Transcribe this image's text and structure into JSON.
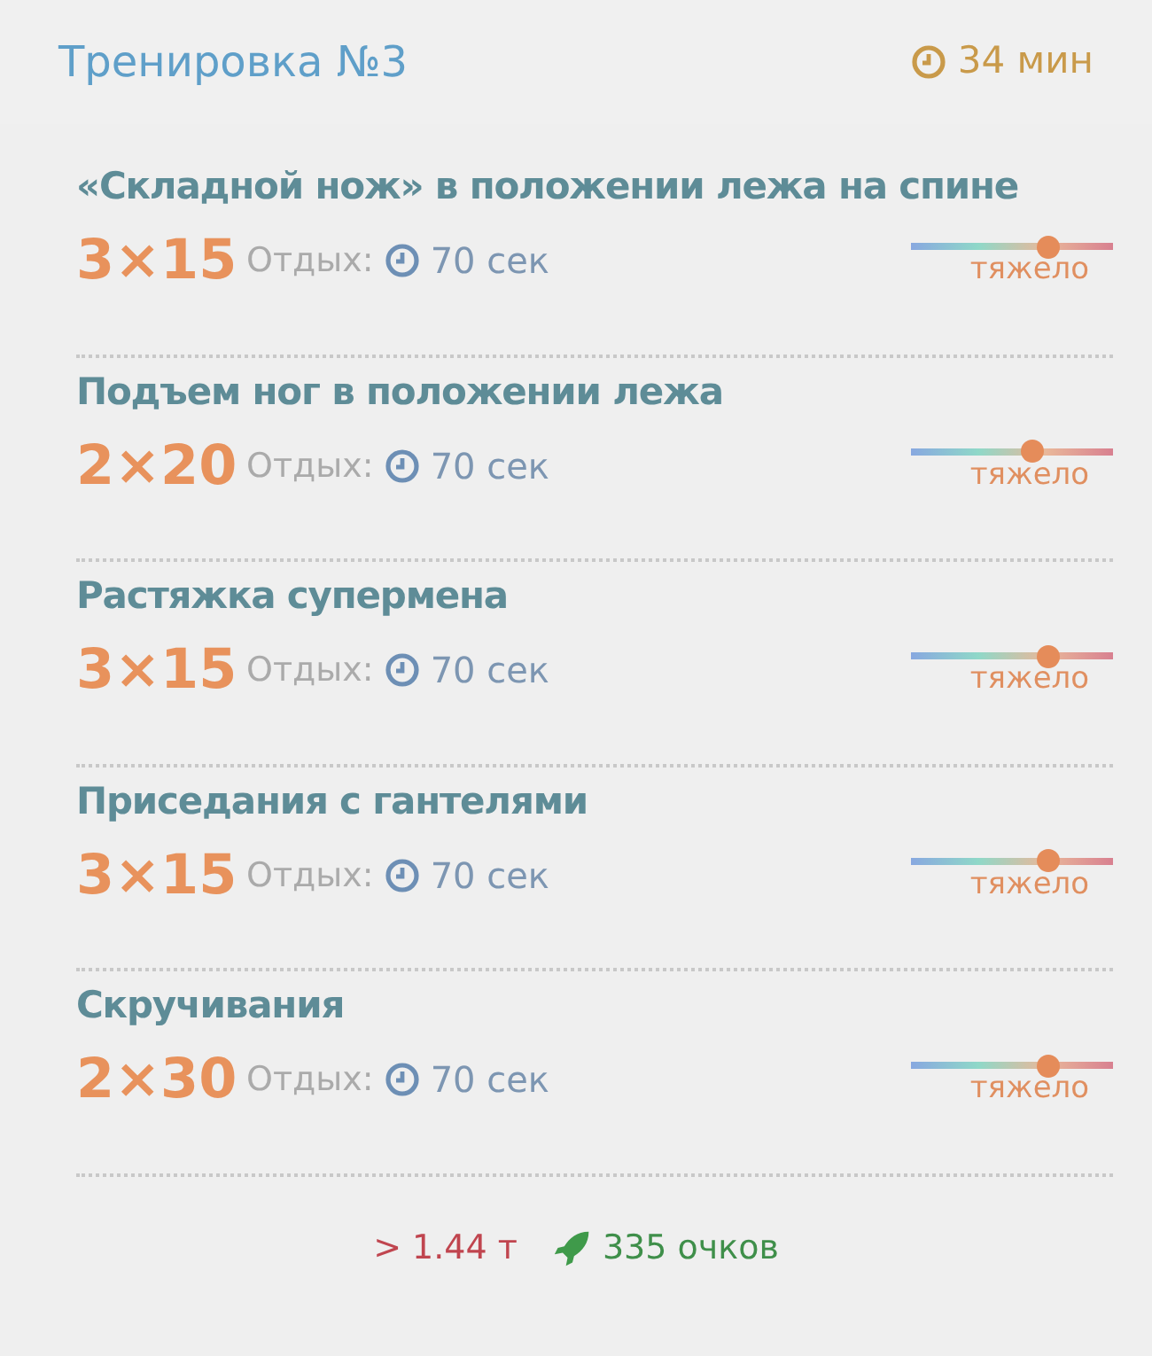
{
  "header": {
    "title": "Тренировка №3",
    "duration": "34 мин"
  },
  "exercises": [
    {
      "name": "«Складной нож» в положении лежа на спине",
      "sets": "3×15",
      "rest_label": "Отдых:",
      "rest": "70 сек",
      "level": 0.68,
      "difficulty": "тяжело"
    },
    {
      "name": "Подъем ног в положении лежа",
      "sets": "2×20",
      "rest_label": "Отдых:",
      "rest": "70 сек",
      "level": 0.6,
      "difficulty": "тяжело"
    },
    {
      "name": "Растяжка супермена",
      "sets": "3×15",
      "rest_label": "Отдых:",
      "rest": "70 сек",
      "level": 0.68,
      "difficulty": "тяжело"
    },
    {
      "name": "Приседания с гантелями",
      "sets": "3×15",
      "rest_label": "Отдых:",
      "rest": "70 сек",
      "level": 0.68,
      "difficulty": "тяжело"
    },
    {
      "name": "Скручивания",
      "sets": "2×30",
      "rest_label": "Отдых:",
      "rest": "70 сек",
      "level": 0.68,
      "difficulty": "тяжело"
    }
  ],
  "footer": {
    "weight": "> 1.44 т",
    "points": "335 очков"
  }
}
